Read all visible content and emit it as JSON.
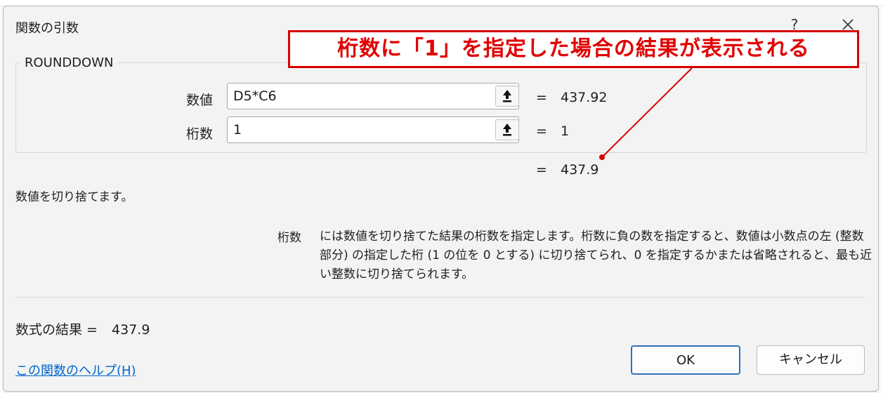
{
  "dialog": {
    "title": "関数の引数",
    "help_glyph": "?",
    "close_icon": "close-icon"
  },
  "function": {
    "name": "ROUNDDOWN",
    "args": [
      {
        "label": "数値",
        "value": "D5*C6",
        "result": "437.92"
      },
      {
        "label": "桁数",
        "value": "1",
        "result": "1"
      }
    ],
    "eq_sign": "=",
    "function_result": "437.9",
    "description": "数値を切り捨てます。",
    "param_name": "桁数",
    "param_description": "には数値を切り捨てた結果の桁数を指定します。桁数に負の数を指定すると、数値は小数点の左 (整数部分) の指定した桁 (1 の位を 0 とする) に切り捨てられ、0 を指定するかまたは省略されると、最も近い整数に切り捨てられます。"
  },
  "footer": {
    "formula_result_label": "数式の結果 =",
    "formula_result_value": "437.9",
    "help_link": "この関数のヘルプ(H)",
    "ok_label": "OK",
    "cancel_label": "キャンセル"
  },
  "annotation": {
    "text": "桁数に「1」を指定した場合の結果が表示される",
    "color": "#e00000"
  },
  "colors": {
    "dialog_bg": "#f3f3f3",
    "link": "#0066cc",
    "ok_border": "#2f6fbd"
  }
}
